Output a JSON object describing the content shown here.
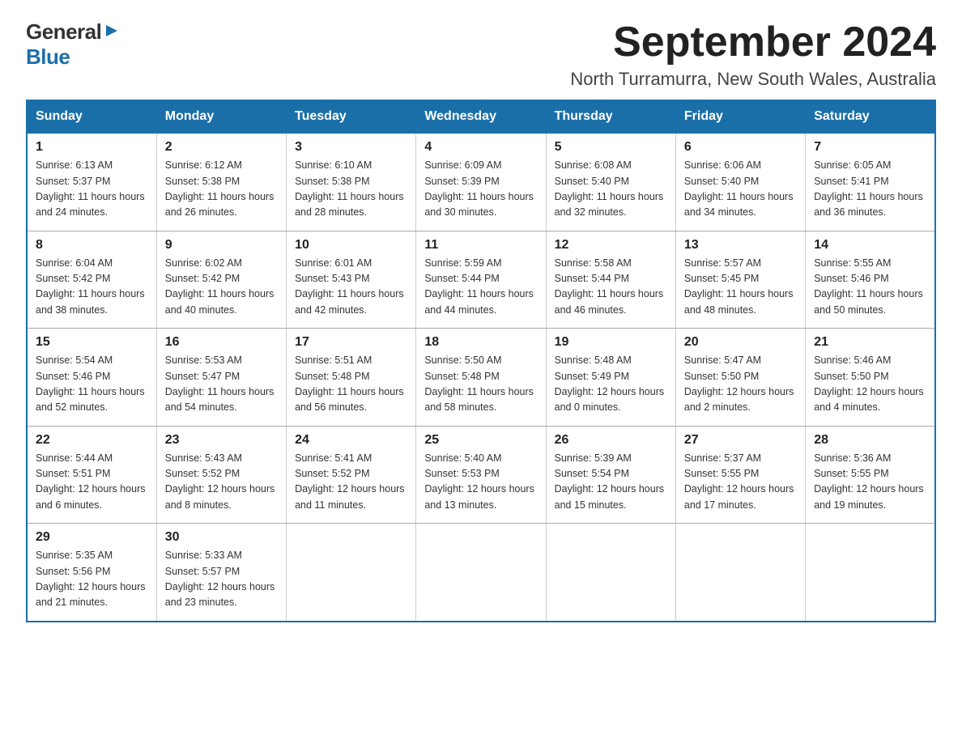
{
  "header": {
    "logo_general": "General",
    "logo_blue": "Blue",
    "month_title": "September 2024",
    "subtitle": "North Turramurra, New South Wales, Australia"
  },
  "weekdays": [
    "Sunday",
    "Monday",
    "Tuesday",
    "Wednesday",
    "Thursday",
    "Friday",
    "Saturday"
  ],
  "weeks": [
    [
      {
        "day": "1",
        "sunrise": "Sunrise: 6:13 AM",
        "sunset": "Sunset: 5:37 PM",
        "daylight": "Daylight: 11 hours and 24 minutes."
      },
      {
        "day": "2",
        "sunrise": "Sunrise: 6:12 AM",
        "sunset": "Sunset: 5:38 PM",
        "daylight": "Daylight: 11 hours and 26 minutes."
      },
      {
        "day": "3",
        "sunrise": "Sunrise: 6:10 AM",
        "sunset": "Sunset: 5:38 PM",
        "daylight": "Daylight: 11 hours and 28 minutes."
      },
      {
        "day": "4",
        "sunrise": "Sunrise: 6:09 AM",
        "sunset": "Sunset: 5:39 PM",
        "daylight": "Daylight: 11 hours and 30 minutes."
      },
      {
        "day": "5",
        "sunrise": "Sunrise: 6:08 AM",
        "sunset": "Sunset: 5:40 PM",
        "daylight": "Daylight: 11 hours and 32 minutes."
      },
      {
        "day": "6",
        "sunrise": "Sunrise: 6:06 AM",
        "sunset": "Sunset: 5:40 PM",
        "daylight": "Daylight: 11 hours and 34 minutes."
      },
      {
        "day": "7",
        "sunrise": "Sunrise: 6:05 AM",
        "sunset": "Sunset: 5:41 PM",
        "daylight": "Daylight: 11 hours and 36 minutes."
      }
    ],
    [
      {
        "day": "8",
        "sunrise": "Sunrise: 6:04 AM",
        "sunset": "Sunset: 5:42 PM",
        "daylight": "Daylight: 11 hours and 38 minutes."
      },
      {
        "day": "9",
        "sunrise": "Sunrise: 6:02 AM",
        "sunset": "Sunset: 5:42 PM",
        "daylight": "Daylight: 11 hours and 40 minutes."
      },
      {
        "day": "10",
        "sunrise": "Sunrise: 6:01 AM",
        "sunset": "Sunset: 5:43 PM",
        "daylight": "Daylight: 11 hours and 42 minutes."
      },
      {
        "day": "11",
        "sunrise": "Sunrise: 5:59 AM",
        "sunset": "Sunset: 5:44 PM",
        "daylight": "Daylight: 11 hours and 44 minutes."
      },
      {
        "day": "12",
        "sunrise": "Sunrise: 5:58 AM",
        "sunset": "Sunset: 5:44 PM",
        "daylight": "Daylight: 11 hours and 46 minutes."
      },
      {
        "day": "13",
        "sunrise": "Sunrise: 5:57 AM",
        "sunset": "Sunset: 5:45 PM",
        "daylight": "Daylight: 11 hours and 48 minutes."
      },
      {
        "day": "14",
        "sunrise": "Sunrise: 5:55 AM",
        "sunset": "Sunset: 5:46 PM",
        "daylight": "Daylight: 11 hours and 50 minutes."
      }
    ],
    [
      {
        "day": "15",
        "sunrise": "Sunrise: 5:54 AM",
        "sunset": "Sunset: 5:46 PM",
        "daylight": "Daylight: 11 hours and 52 minutes."
      },
      {
        "day": "16",
        "sunrise": "Sunrise: 5:53 AM",
        "sunset": "Sunset: 5:47 PM",
        "daylight": "Daylight: 11 hours and 54 minutes."
      },
      {
        "day": "17",
        "sunrise": "Sunrise: 5:51 AM",
        "sunset": "Sunset: 5:48 PM",
        "daylight": "Daylight: 11 hours and 56 minutes."
      },
      {
        "day": "18",
        "sunrise": "Sunrise: 5:50 AM",
        "sunset": "Sunset: 5:48 PM",
        "daylight": "Daylight: 11 hours and 58 minutes."
      },
      {
        "day": "19",
        "sunrise": "Sunrise: 5:48 AM",
        "sunset": "Sunset: 5:49 PM",
        "daylight": "Daylight: 12 hours and 0 minutes."
      },
      {
        "day": "20",
        "sunrise": "Sunrise: 5:47 AM",
        "sunset": "Sunset: 5:50 PM",
        "daylight": "Daylight: 12 hours and 2 minutes."
      },
      {
        "day": "21",
        "sunrise": "Sunrise: 5:46 AM",
        "sunset": "Sunset: 5:50 PM",
        "daylight": "Daylight: 12 hours and 4 minutes."
      }
    ],
    [
      {
        "day": "22",
        "sunrise": "Sunrise: 5:44 AM",
        "sunset": "Sunset: 5:51 PM",
        "daylight": "Daylight: 12 hours and 6 minutes."
      },
      {
        "day": "23",
        "sunrise": "Sunrise: 5:43 AM",
        "sunset": "Sunset: 5:52 PM",
        "daylight": "Daylight: 12 hours and 8 minutes."
      },
      {
        "day": "24",
        "sunrise": "Sunrise: 5:41 AM",
        "sunset": "Sunset: 5:52 PM",
        "daylight": "Daylight: 12 hours and 11 minutes."
      },
      {
        "day": "25",
        "sunrise": "Sunrise: 5:40 AM",
        "sunset": "Sunset: 5:53 PM",
        "daylight": "Daylight: 12 hours and 13 minutes."
      },
      {
        "day": "26",
        "sunrise": "Sunrise: 5:39 AM",
        "sunset": "Sunset: 5:54 PM",
        "daylight": "Daylight: 12 hours and 15 minutes."
      },
      {
        "day": "27",
        "sunrise": "Sunrise: 5:37 AM",
        "sunset": "Sunset: 5:55 PM",
        "daylight": "Daylight: 12 hours and 17 minutes."
      },
      {
        "day": "28",
        "sunrise": "Sunrise: 5:36 AM",
        "sunset": "Sunset: 5:55 PM",
        "daylight": "Daylight: 12 hours and 19 minutes."
      }
    ],
    [
      {
        "day": "29",
        "sunrise": "Sunrise: 5:35 AM",
        "sunset": "Sunset: 5:56 PM",
        "daylight": "Daylight: 12 hours and 21 minutes."
      },
      {
        "day": "30",
        "sunrise": "Sunrise: 5:33 AM",
        "sunset": "Sunset: 5:57 PM",
        "daylight": "Daylight: 12 hours and 23 minutes."
      },
      null,
      null,
      null,
      null,
      null
    ]
  ]
}
